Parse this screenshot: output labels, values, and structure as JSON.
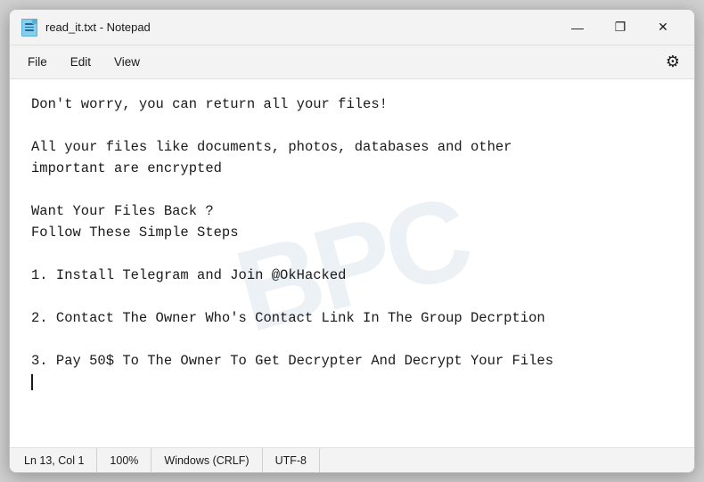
{
  "window": {
    "title": "read_it.txt - Notepad",
    "icon_lines": 3
  },
  "controls": {
    "minimize": "—",
    "maximize": "❐",
    "close": "✕"
  },
  "menu": {
    "file": "File",
    "edit": "Edit",
    "view": "View"
  },
  "watermark": "BPC",
  "content": {
    "text_line1": "Don't worry, you can return all your files!",
    "text_line2": "",
    "text_line3": "All your files like documents, photos, databases and other",
    "text_line4": "important are encrypted",
    "text_line5": "",
    "text_line6": "Want Your Files Back ?",
    "text_line7": "Follow These Simple Steps",
    "text_line8": "",
    "text_line9": "1. Install Telegram and Join @OkHacked",
    "text_line10": "",
    "text_line11": "2. Contact The Owner Who's Contact Link In The Group Decrption",
    "text_line12": "",
    "text_line13": "3. Pay 50$ To The Owner To Get Decrypter And Decrypt Your Files"
  },
  "statusbar": {
    "position": "Ln 13, Col 1",
    "zoom": "100%",
    "line_ending": "Windows (CRLF)",
    "encoding": "UTF-8"
  }
}
